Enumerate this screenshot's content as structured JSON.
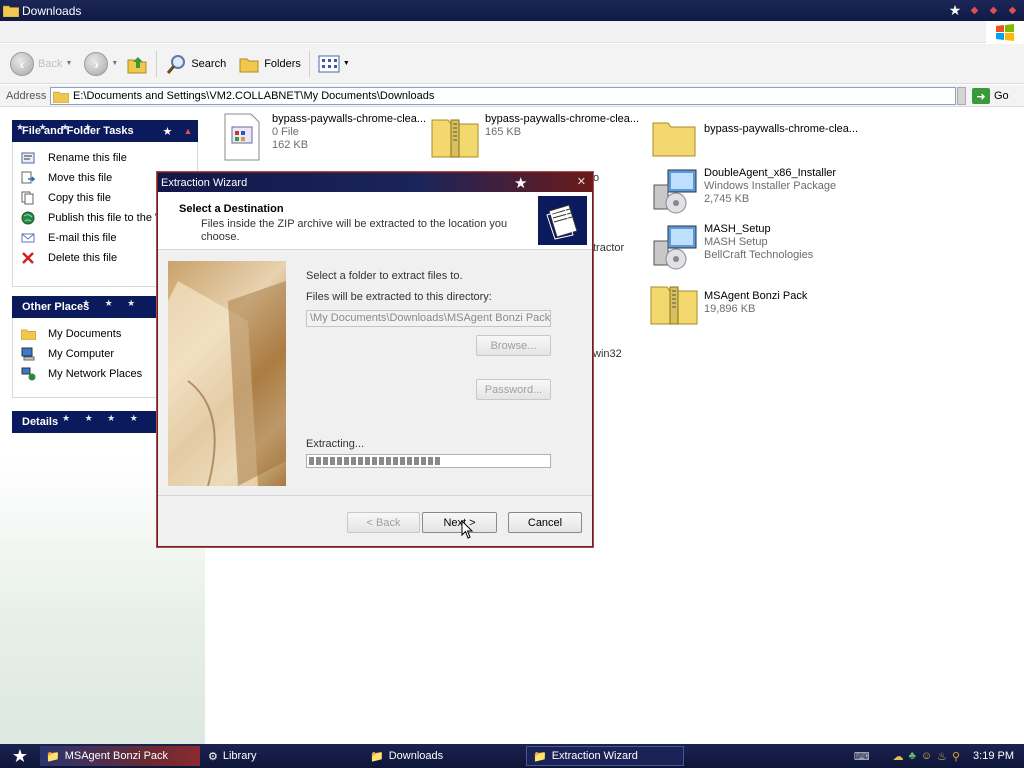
{
  "window": {
    "title": "Downloads"
  },
  "toolbar": {
    "back_label": "Back",
    "search_label": "Search",
    "folders_label": "Folders"
  },
  "address": {
    "label": "Address",
    "value": "E:\\Documents and Settings\\VM2.COLLABNET\\My Documents\\Downloads",
    "go_label": "Go"
  },
  "sidebar": {
    "tasks": {
      "title": "File and Folder Tasks",
      "items": [
        {
          "label": "Rename this file",
          "icon": "rename-icon"
        },
        {
          "label": "Move this file",
          "icon": "move-icon"
        },
        {
          "label": "Copy this file",
          "icon": "copy-icon"
        },
        {
          "label": "Publish this file to the W",
          "icon": "publish-icon"
        },
        {
          "label": "E-mail this file",
          "icon": "email-icon"
        },
        {
          "label": "Delete this file",
          "icon": "delete-icon"
        }
      ]
    },
    "places": {
      "title": "Other Places",
      "items": [
        {
          "label": "My Documents",
          "icon": "folder-icon"
        },
        {
          "label": "My Computer",
          "icon": "computer-icon"
        },
        {
          "label": "My Network Places",
          "icon": "network-icon"
        }
      ]
    },
    "details": {
      "title": "Details"
    }
  },
  "files": [
    {
      "name": "bypass-paywalls-chrome-clea...",
      "line2": "0 File",
      "line3": "162 KB",
      "icon": "file-icon"
    },
    {
      "name": "bypass-paywalls-chrome-clea...",
      "line2": "165 KB",
      "line3": "",
      "icon": "zip-folder-icon"
    },
    {
      "name": "bypass-paywalls-chrome-clea...",
      "line2": "",
      "line3": "",
      "icon": "folder-icon"
    },
    {
      "name": "DoubleAgent_x86_Installer",
      "line2": "Windows Installer Package",
      "line3": "2,745 KB",
      "icon": "installer-icon"
    },
    {
      "name": "MASH_Setup",
      "line2": "MASH Setup",
      "line3": "BellCraft Technologies",
      "icon": "installer-icon"
    },
    {
      "name": "MSAgent Bonzi Pack",
      "line2": "19,896 KB",
      "line3": "",
      "icon": "zip-folder-icon"
    }
  ],
  "hidden_fragments": {
    "frag1": "o",
    "frag2": "tractor",
    "frag3": "win32"
  },
  "wizard": {
    "title": "Extraction Wizard",
    "heading": "Select a Destination",
    "subheading": "Files inside the ZIP archive will be extracted to the location you choose.",
    "select_label": "Select a folder to extract files to.",
    "dir_label": "Files will be extracted to this directory:",
    "path_value": "\\My Documents\\Downloads\\MSAgent Bonzi Pack",
    "browse_label": "Browse...",
    "password_label": "Password...",
    "extracting_label": "Extracting...",
    "progress": 0.55,
    "back_label": "< Back",
    "next_label": "Next >",
    "cancel_label": "Cancel"
  },
  "taskbar": {
    "items": [
      {
        "label": "MSAgent Bonzi Pack",
        "icon": "folder-icon"
      },
      {
        "label": "Library",
        "icon": "library-icon"
      },
      {
        "label": "Downloads",
        "icon": "folder-icon"
      },
      {
        "label": "Extraction Wizard",
        "icon": "folder-icon"
      }
    ],
    "clock": "3:19 PM"
  }
}
